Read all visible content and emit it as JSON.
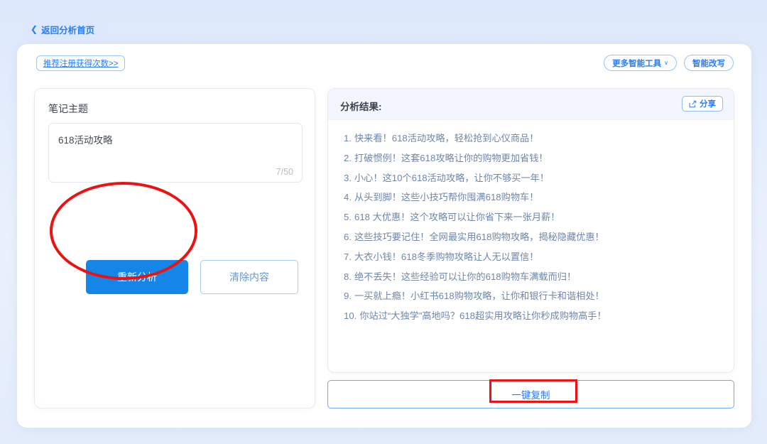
{
  "theme": {
    "accent": "#2b7cf0",
    "primary_button": "#1585e8",
    "annotation": "#ee1111",
    "page_bg": "#e4edfc"
  },
  "header": {
    "back_label": "返回分析首页",
    "back_icon": "chevron-left-icon"
  },
  "toolbar": {
    "recommend_label": "推荐注册获得次数>>",
    "more_tools_label": "更多智能工具",
    "more_tools_caret": "∨",
    "rewrite_label": "智能改写"
  },
  "left_panel": {
    "label": "笔记主题",
    "topic_value": "618活动攻略",
    "counter": "7/50",
    "reanalyze_label": "重新分析",
    "clear_label": "清除内容"
  },
  "right_panel": {
    "title": "分析结果:",
    "share_label": "分享",
    "share_icon": "share-icon",
    "results": [
      {
        "index": "1.",
        "text": "快来看！618活动攻略，轻松抢到心仪商品！"
      },
      {
        "index": "2.",
        "text": "打破惯例！这套618攻略让你的购物更加省钱！"
      },
      {
        "index": "3.",
        "text": "小心！这10个618活动攻略，让你不够买一年！"
      },
      {
        "index": "4.",
        "text": "从头到脚！这些小技巧帮你囤满618购物车！"
      },
      {
        "index": "5.",
        "text": "618 大优惠！这个攻略可以让你省下来一张月薪！"
      },
      {
        "index": "6.",
        "text": "这些技巧要记住！全网最实用618购物攻略，揭秘隐藏优惠！"
      },
      {
        "index": "7.",
        "text": "大衣小钱！618冬季购物攻略让人无以置信！"
      },
      {
        "index": "8.",
        "text": "绝不丢失！这些经验可以让你的618购物车满载而归！"
      },
      {
        "index": "9.",
        "text": "一买就上瘾！小红书618购物攻略，让你和银行卡和谐相处！"
      },
      {
        "index": "10.",
        "text": "你站过“大独学”高地吗？618超实用攻略让你秒成购物高手！"
      }
    ]
  },
  "footer": {
    "copy_label": "一键复制"
  }
}
